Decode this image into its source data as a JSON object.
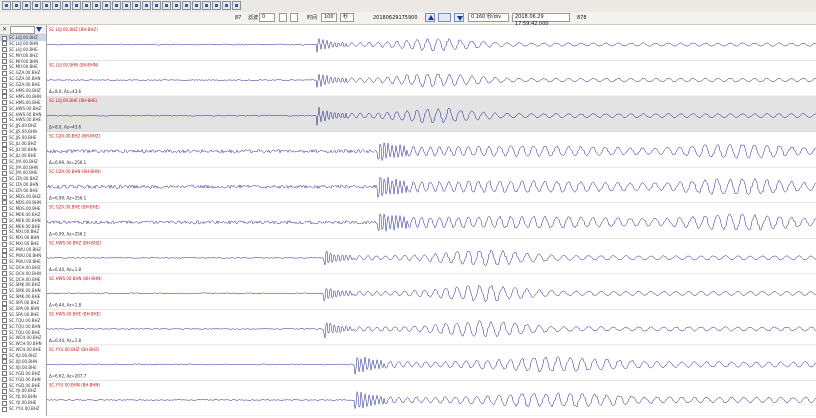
{
  "toolbar": {
    "icons": [
      "open-icon",
      "save-icon",
      "print-icon",
      "list-icon",
      "config-icon",
      "undo-icon",
      "back-icon",
      "forward-icon",
      "zoom-in-icon",
      "zoom-out-icon",
      "zoom-x-icon",
      "zoom-y-icon",
      "pick-p-icon",
      "pick-s-icon",
      "filter-icon",
      "measure-icon",
      "amplitude-icon",
      "select-icon",
      "align-icon",
      "rotate-icon",
      "clear-icon",
      "grid-icon",
      "auto-icon",
      "refresh-icon"
    ]
  },
  "controls": {
    "left_label": "87",
    "mode_label": "滤波",
    "mode_value": "0",
    "field_small1": "",
    "field_small2": "",
    "rate_label": "时间",
    "rate_value": "100",
    "unit_value": "秒",
    "event_id": "20180629175900",
    "seconds_value": "0.160 秒/div",
    "datetime_value": "2018.06.29 17:59:42.000",
    "count_value": "878"
  },
  "sidebar": {
    "items": [
      {
        "label": "SC.LUJ.00.BHZ",
        "active": true
      },
      {
        "label": "SC.LUJ.00.BHN",
        "active": false
      },
      {
        "label": "SC.LUJ.00.BHE",
        "active": false
      },
      {
        "label": "SC.MIY.00.BHZ",
        "active": false
      },
      {
        "label": "SC.MIY.00.BHN",
        "active": false
      },
      {
        "label": "SC.MIY.00.BHE",
        "active": false
      },
      {
        "label": "SC.GZA.00.BHZ",
        "active": false
      },
      {
        "label": "SC.GZA.00.BHN",
        "active": false
      },
      {
        "label": "SC.GZA.00.BHE",
        "active": false
      },
      {
        "label": "SC.HMS.00.BHZ",
        "active": false
      },
      {
        "label": "SC.HMS.00.BHN",
        "active": false
      },
      {
        "label": "SC.HMS.00.BHE",
        "active": false
      },
      {
        "label": "SC.HWS.00.BHZ",
        "active": false
      },
      {
        "label": "SC.HWS.00.BHN",
        "active": false
      },
      {
        "label": "SC.HWS.00.BHE",
        "active": false
      },
      {
        "label": "SC.JJS.00.BHZ",
        "active": false
      },
      {
        "label": "SC.JJS.00.BHN",
        "active": false
      },
      {
        "label": "SC.JJS.00.BHE",
        "active": false
      },
      {
        "label": "SC.JLI.00.BHZ",
        "active": false
      },
      {
        "label": "SC.JLI.00.BHN",
        "active": false
      },
      {
        "label": "SC.JLI.00.BHE",
        "active": false
      },
      {
        "label": "SC.JYA.00.BHZ",
        "active": false
      },
      {
        "label": "SC.JYA.00.BHN",
        "active": false
      },
      {
        "label": "SC.JYA.00.BHE",
        "active": false
      },
      {
        "label": "SC.LTA.00.BHZ",
        "active": false
      },
      {
        "label": "SC.LTA.00.BHN",
        "active": false
      },
      {
        "label": "SC.LTA.00.BHE",
        "active": false
      },
      {
        "label": "SC.MDS.00.BHZ",
        "active": false
      },
      {
        "label": "SC.MDS.00.BHN",
        "active": false
      },
      {
        "label": "SC.MDS.00.BHE",
        "active": false
      },
      {
        "label": "SC.MEK.00.BHZ",
        "active": false
      },
      {
        "label": "SC.MEK.00.BHN",
        "active": false
      },
      {
        "label": "SC.MEK.00.BHE",
        "active": false
      },
      {
        "label": "SC.MXI.00.BHZ",
        "active": false
      },
      {
        "label": "SC.MXI.00.BHN",
        "active": false
      },
      {
        "label": "SC.MXI.00.BHE",
        "active": false
      },
      {
        "label": "SC.PWU.00.BHZ",
        "active": false
      },
      {
        "label": "SC.PWU.00.BHN",
        "active": false
      },
      {
        "label": "SC.PWU.00.BHE",
        "active": false
      },
      {
        "label": "SC.QCH.00.BHZ",
        "active": false
      },
      {
        "label": "SC.QCH.00.BHN",
        "active": false
      },
      {
        "label": "SC.QCH.00.BHE",
        "active": false
      },
      {
        "label": "SC.SMK.00.BHZ",
        "active": false
      },
      {
        "label": "SC.SMK.00.BHN",
        "active": false
      },
      {
        "label": "SC.SMK.00.BHE",
        "active": false
      },
      {
        "label": "SC.SPA.00.BHZ",
        "active": false
      },
      {
        "label": "SC.SPA.00.BHN",
        "active": false
      },
      {
        "label": "SC.SPA.00.BHE",
        "active": false
      },
      {
        "label": "SC.TQU.00.BHZ",
        "active": false
      },
      {
        "label": "SC.TQU.00.BHN",
        "active": false
      },
      {
        "label": "SC.TQU.00.BHE",
        "active": false
      },
      {
        "label": "SC.WCH.00.BHZ",
        "active": false
      },
      {
        "label": "SC.WCH.00.BHN",
        "active": false
      },
      {
        "label": "SC.WCH.00.BHE",
        "active": false
      },
      {
        "label": "SC.XJI.00.BHZ",
        "active": false
      },
      {
        "label": "SC.XJI.00.BHN",
        "active": false
      },
      {
        "label": "SC.XJI.00.BHE",
        "active": false
      },
      {
        "label": "SC.YGD.00.BHZ",
        "active": false
      },
      {
        "label": "SC.YGD.00.BHN",
        "active": false
      },
      {
        "label": "SC.YGD.00.BHE",
        "active": false
      },
      {
        "label": "SC.YJI.00.BHZ",
        "active": false
      },
      {
        "label": "SC.YJI.00.BHN",
        "active": false
      },
      {
        "label": "SC.YJI.00.BHE",
        "active": false
      },
      {
        "label": "SC.YYU.00.BHZ",
        "active": false
      }
    ]
  },
  "traces": [
    {
      "name": "SC.LUJ.00.BHZ (BH-BHZ)",
      "dist": "",
      "highlight": false,
      "onset": 0.35,
      "amp": 0.8,
      "pattern": "early"
    },
    {
      "name": "SC.LUJ.00.BHN (BH-BHN)",
      "dist": "Δ=8.0, Az=43.6",
      "highlight": false,
      "onset": 0.35,
      "amp": 0.9,
      "pattern": "early"
    },
    {
      "name": "SC.LUJ.00.BHE (BH-BHE)",
      "dist": "Δ=8.0, Az=43.6",
      "highlight": true,
      "onset": 0.35,
      "amp": 1.0,
      "pattern": "early"
    },
    {
      "name": "SC.GZA.00.BHZ (BH-BHZ)",
      "dist": "Δ=6.99, Az=256.1",
      "highlight": false,
      "onset": 0.43,
      "amp": 0.9,
      "pattern": "noisy"
    },
    {
      "name": "SC.GZA.00.BHN (BH-BHN)",
      "dist": "Δ=6.99, Az=256.1",
      "highlight": false,
      "onset": 0.43,
      "amp": 1.0,
      "pattern": "noisy"
    },
    {
      "name": "SC.GZA.00.BHE (BH-BHE)",
      "dist": "Δ=6.99, Az=256.1",
      "highlight": false,
      "onset": 0.43,
      "amp": 1.0,
      "pattern": "noisy"
    },
    {
      "name": "SC.HWS.00.BHZ (BH-BHZ)",
      "dist": "Δ=6.44, Az=1.8",
      "highlight": false,
      "onset": 0.36,
      "amp": 0.9,
      "pattern": "mid"
    },
    {
      "name": "SC.HWS.00.BHN (BH-BHN)",
      "dist": "Δ=6.44, Az=1.8",
      "highlight": false,
      "onset": 0.36,
      "amp": 0.9,
      "pattern": "mid"
    },
    {
      "name": "SC.HWS.00.BHE (BH-BHE)",
      "dist": "Δ=6.44, Az=1.8",
      "highlight": false,
      "onset": 0.36,
      "amp": 0.9,
      "pattern": "mid"
    },
    {
      "name": "SC.YYU.00.BHZ (BH-BHZ)",
      "dist": "Δ=6.62, Az=207.7",
      "highlight": false,
      "onset": 0.4,
      "amp": 1.0,
      "pattern": "late"
    },
    {
      "name": "SC.YYU.00.BHN (BH-BHN)",
      "dist": "",
      "highlight": false,
      "onset": 0.4,
      "amp": 1.0,
      "pattern": "late"
    }
  ],
  "colors": {
    "trace_line": "#1c1f8a",
    "trace_label": "#c01818",
    "highlight_bg": "#e3e3e3",
    "divider": "#cccccc"
  }
}
